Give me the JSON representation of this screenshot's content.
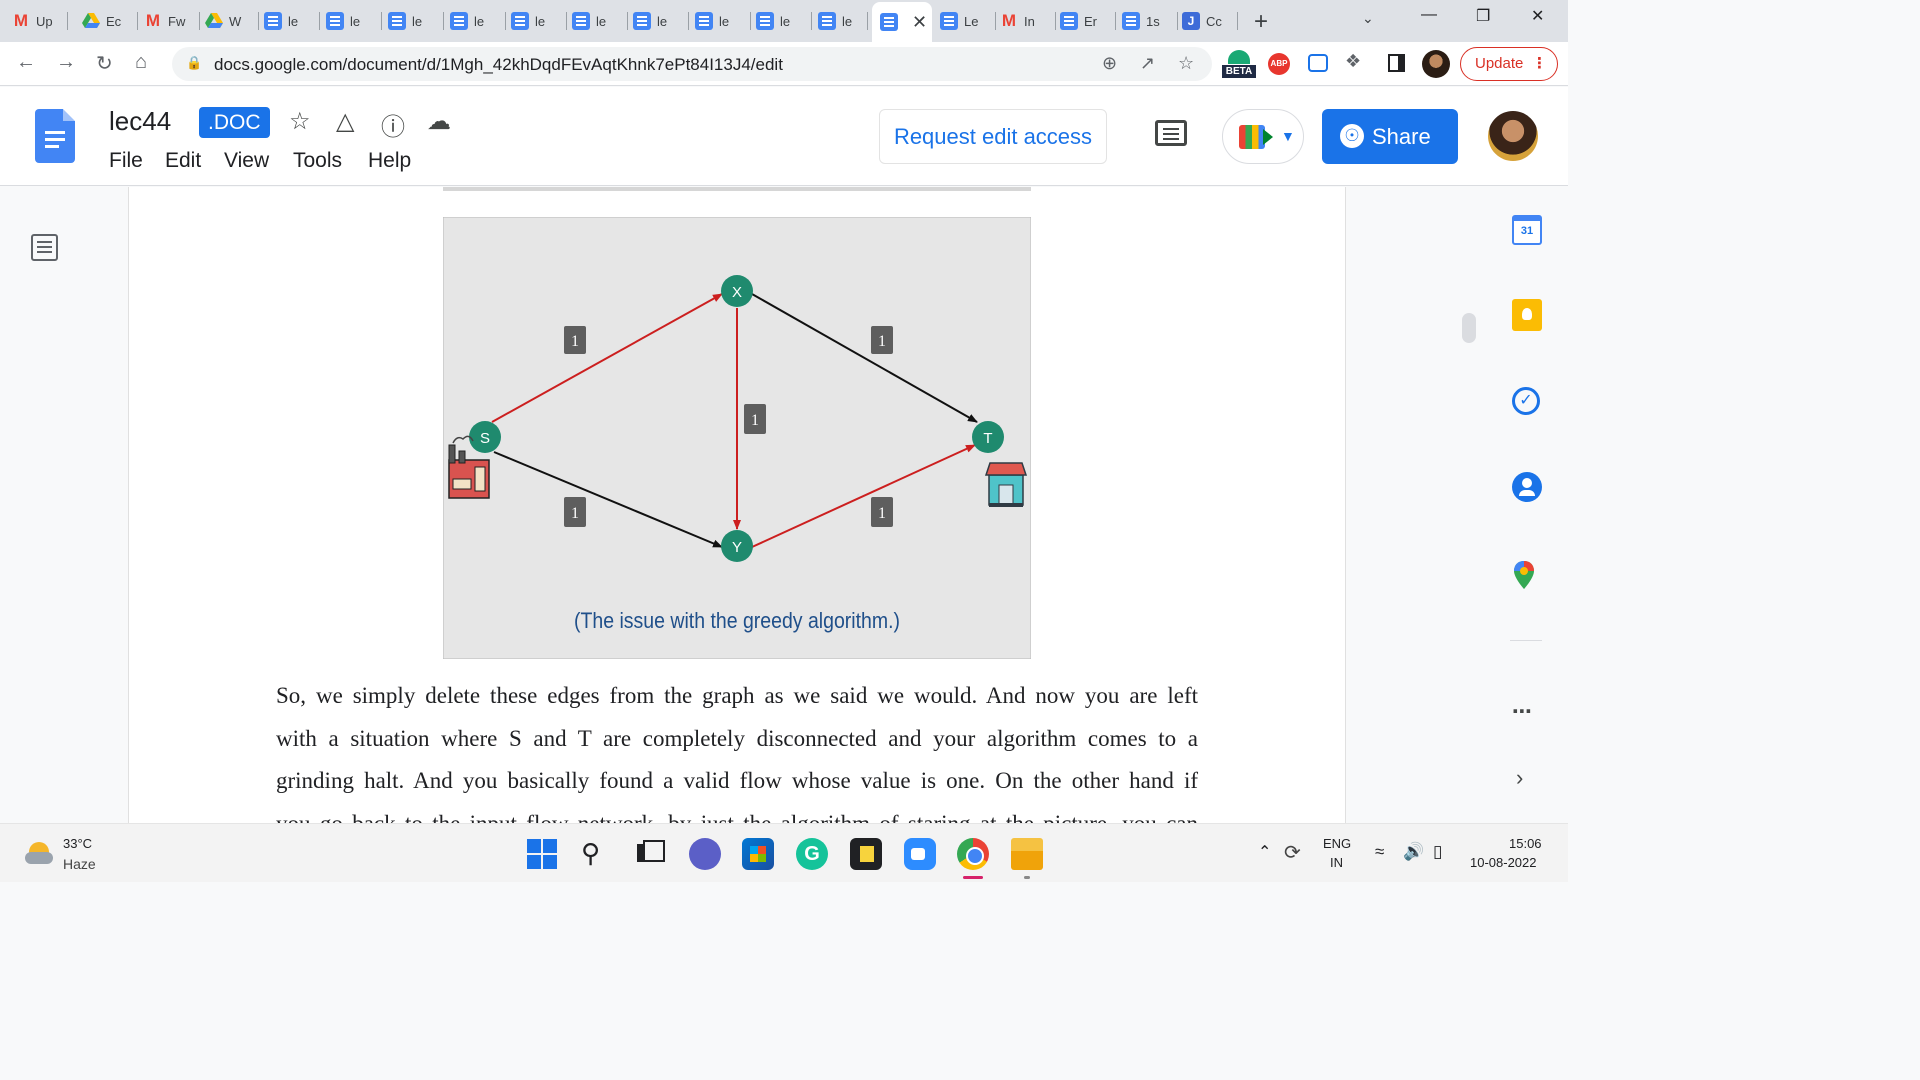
{
  "browser": {
    "tabs": [
      {
        "label": "Up",
        "icon": "gmail-icon"
      },
      {
        "label": "Ec",
        "icon": "drive-icon"
      },
      {
        "label": "Fw",
        "icon": "gmail-icon"
      },
      {
        "label": "W",
        "icon": "drive-icon"
      },
      {
        "label": "le",
        "icon": "docs-icon"
      },
      {
        "label": "le",
        "icon": "docs-icon"
      },
      {
        "label": "le",
        "icon": "docs-icon"
      },
      {
        "label": "le",
        "icon": "docs-icon"
      },
      {
        "label": "le",
        "icon": "docs-icon"
      },
      {
        "label": "le",
        "icon": "docs-icon"
      },
      {
        "label": "le",
        "icon": "docs-icon"
      },
      {
        "label": "le",
        "icon": "docs-icon"
      },
      {
        "label": "le",
        "icon": "docs-icon"
      },
      {
        "label": "le",
        "icon": "docs-icon"
      },
      {
        "label": "",
        "icon": "docs-icon",
        "active": true
      },
      {
        "label": "Le",
        "icon": "docs-icon"
      },
      {
        "label": "In",
        "icon": "gmail-icon"
      },
      {
        "label": "Er",
        "icon": "docs-icon"
      },
      {
        "label": "1s",
        "icon": "docs-icon"
      },
      {
        "label": "Cc",
        "icon": "jamboard-icon"
      }
    ],
    "close_glyph": "✕",
    "new_tab_glyph": "+",
    "url": "docs.google.com/document/d/1Mgh_42khDqdFEvAqtKhnk7ePt84I13J4/edit",
    "extension_beta_label": "BETA",
    "abp_label": "ABP",
    "update_label": "Update",
    "update_menu_glyph": "⋮"
  },
  "docs": {
    "title": "lec44",
    "file_badge": ".DOC",
    "menu": [
      "File",
      "Edit",
      "View",
      "Tools",
      "Help"
    ],
    "request_edit_label": "Request edit access",
    "share_label": "Share",
    "accent_color": "#1a73e8"
  },
  "figure": {
    "caption": "(The issue with the greedy algorithm.)",
    "nodes": [
      "S",
      "X",
      "Y",
      "T"
    ],
    "edge_labels": [
      "1",
      "1",
      "1",
      "1",
      "1"
    ],
    "highlight_color": "#cc1f1f",
    "node_color": "#1f8a6e"
  },
  "body_lines": [
    "So, we simply delete these edges from the graph as we said we would. And now you are left",
    "with a situation where S and T are completely disconnected and your algorithm comes to a",
    "grinding halt. And you basically found a valid flow whose value is one. On the other hand if",
    "you go back to the input flow network, by just the algorithm of staring at the picture, you can"
  ],
  "side_panel": {
    "calendar_day": "31"
  },
  "taskbar": {
    "temperature": "33°C",
    "weather": "Haze",
    "lang_line1": "ENG",
    "lang_line2": "IN",
    "time": "15:06",
    "date": "10-08-2022"
  }
}
